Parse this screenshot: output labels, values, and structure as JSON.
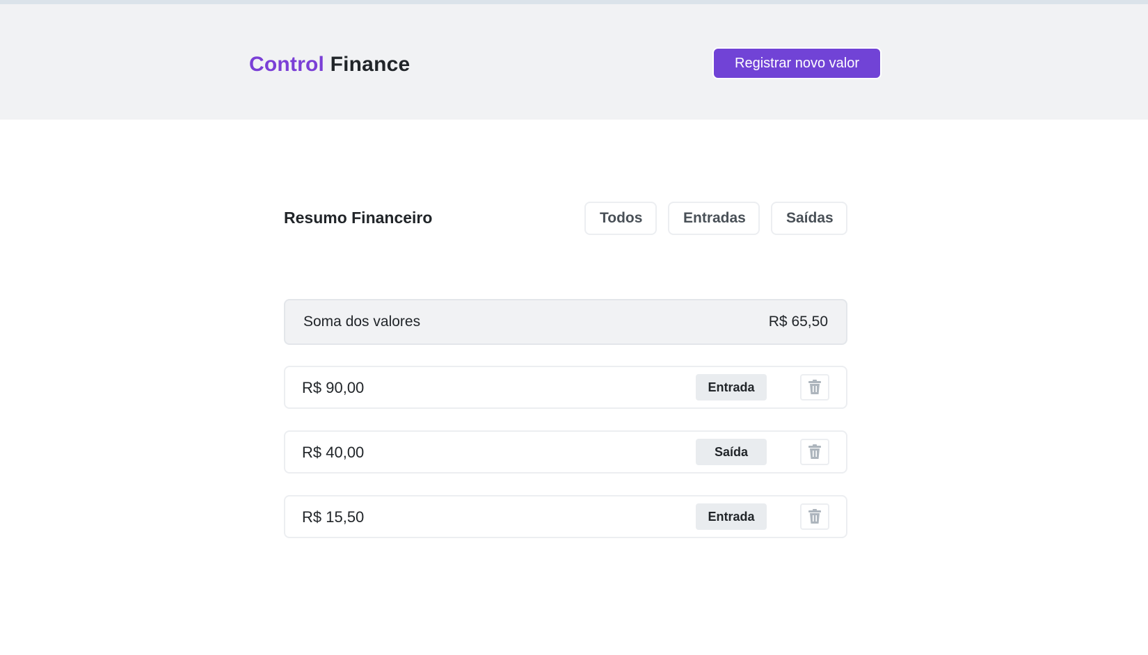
{
  "brand": {
    "accent": "Control",
    "rest": "Finance"
  },
  "header": {
    "register_label": "Registrar novo valor"
  },
  "summary": {
    "title": "Resumo Financeiro",
    "filters": [
      "Todos",
      "Entradas",
      "Saídas"
    ]
  },
  "total": {
    "label": "Soma dos valores",
    "value": "R$ 65,50"
  },
  "entries": [
    {
      "value": "R$ 90,00",
      "type": "Entrada"
    },
    {
      "value": "R$ 40,00",
      "type": "Saída"
    },
    {
      "value": "R$ 15,50",
      "type": "Entrada"
    }
  ],
  "icons": {
    "delete": "trash-icon"
  },
  "colors": {
    "brand_accent": "#7a3fd6",
    "primary_button": "#7143d6",
    "header_bg": "#f1f2f4",
    "type_badge_bg": "#e9ecef",
    "trash_icon": "#adb5bd"
  }
}
